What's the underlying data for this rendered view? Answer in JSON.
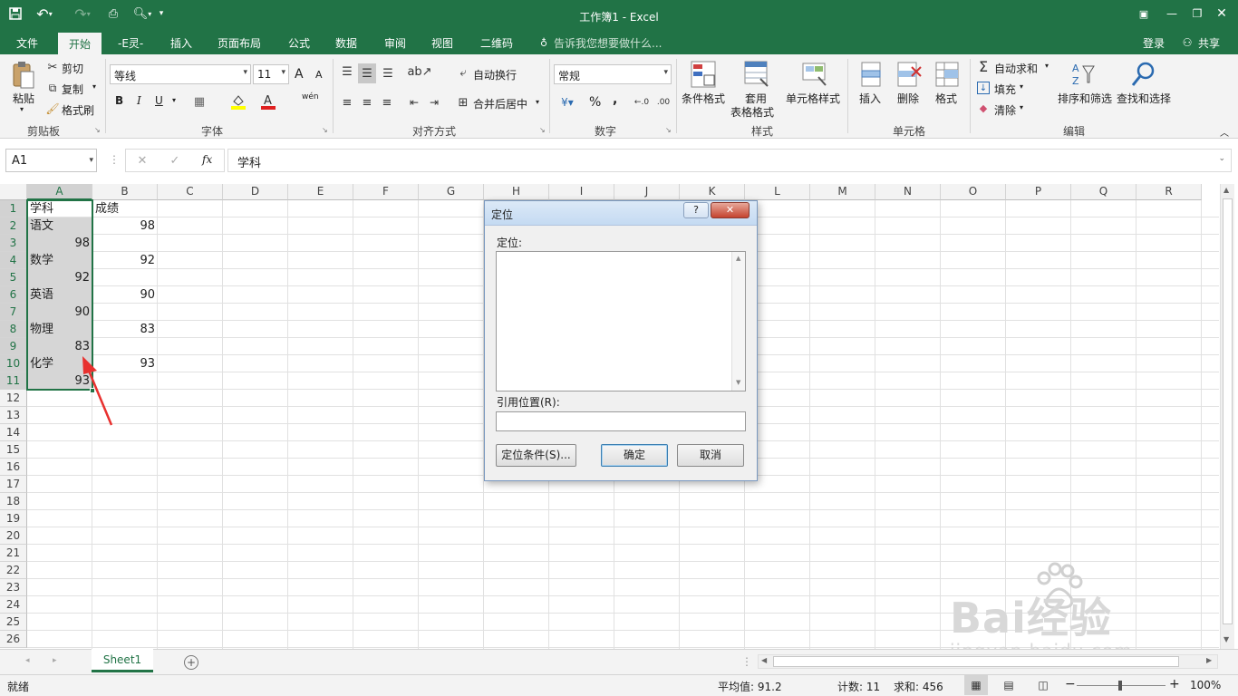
{
  "window": {
    "title": "工作簿1 - Excel"
  },
  "qat": {
    "save_icon": "save-icon",
    "undo_icon": "undo-icon",
    "redo_icon": "redo-icon"
  },
  "tabs": [
    "文件",
    "开始",
    "-E灵-",
    "插入",
    "页面布局",
    "公式",
    "数据",
    "审阅",
    "视图",
    "二维码"
  ],
  "tell_me": "告诉我您想要做什么...",
  "account": {
    "login": "登录",
    "share": "共享"
  },
  "ribbon": {
    "clipboard": {
      "paste": "粘贴",
      "cut": "剪切",
      "copy": "复制",
      "painter": "格式刷",
      "group": "剪贴板"
    },
    "font": {
      "name": "等线",
      "size": "11",
      "bold": "B",
      "italic": "I",
      "underline": "U",
      "group": "字体",
      "grow": "A",
      "shrink": "A",
      "phonetic": "wén"
    },
    "align": {
      "wrap": "自动换行",
      "merge": "合并后居中",
      "group": "对齐方式"
    },
    "number": {
      "format": "常规",
      "percent": "%",
      "comma": ",",
      "group": "数字"
    },
    "styles": {
      "cond": "条件格式",
      "table1": "套用",
      "table2": "表格格式",
      "cell_styles": "单元格样式",
      "group": "样式"
    },
    "cells": {
      "insert": "插入",
      "delete": "删除",
      "format": "格式",
      "group": "单元格"
    },
    "editing": {
      "autosum": "自动求和",
      "fill": "填充",
      "clear": "清除",
      "sort": "排序和筛选",
      "find": "查找和选择",
      "group": "编辑"
    }
  },
  "formula_bar": {
    "name_box": "A1",
    "fx": "fx",
    "content": "学科"
  },
  "columns": [
    "A",
    "B",
    "C",
    "D",
    "E",
    "F",
    "G",
    "H",
    "I",
    "J",
    "K",
    "L",
    "M",
    "N",
    "O",
    "P",
    "Q",
    "R"
  ],
  "rows": [
    "1",
    "2",
    "3",
    "4",
    "5",
    "6",
    "7",
    "8",
    "9",
    "10",
    "11",
    "12",
    "13",
    "14",
    "15",
    "16",
    "17",
    "18",
    "19",
    "20",
    "21",
    "22",
    "23",
    "24",
    "25",
    "26"
  ],
  "cells": {
    "A1": "学科",
    "B1": "成绩",
    "A2": "语文",
    "B2": "98",
    "A3": "98",
    "A4": "数学",
    "B4": "92",
    "A5": "92",
    "A6": "英语",
    "B6": "90",
    "A7": "90",
    "A8": "物理",
    "B8": "83",
    "A9": "83",
    "A10": "化学",
    "B10": "93",
    "A11": "93"
  },
  "dialog": {
    "title": "定位",
    "help": "?",
    "close": "✕",
    "goto_label": "定位:",
    "ref_label": "引用位置(R):",
    "special_btn": "定位条件(S)...",
    "ok": "确定",
    "cancel": "取消"
  },
  "sheets": {
    "active": "Sheet1"
  },
  "status": {
    "ready": "就绪",
    "average": "平均值: 91.2",
    "count": "计数: 11",
    "sum": "求和: 456",
    "zoom": "100%"
  },
  "watermark": {
    "text": "Bai经验",
    "url": "jingyan.baidu.com"
  },
  "colors": {
    "excel_green": "#217346",
    "selection_fill": "#d6d6d6",
    "arrow": "#e8312f"
  }
}
